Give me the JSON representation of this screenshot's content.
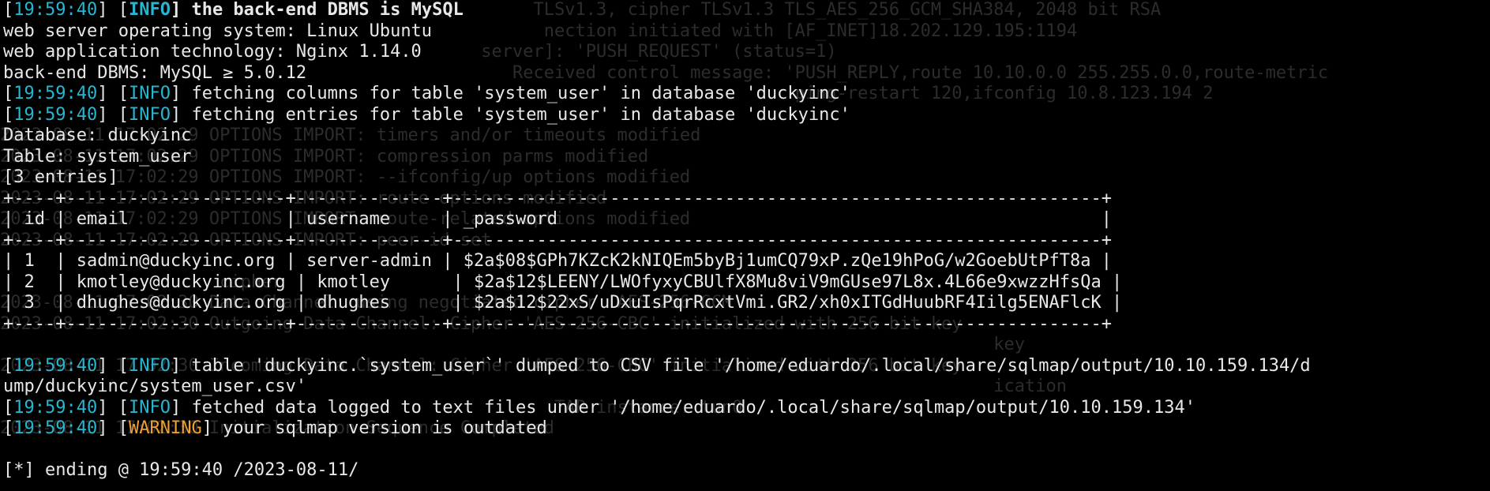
{
  "ghost_lines": [
    "                                                   TLSv1.3, cipher TLSv1.3 TLS_AES_256_GCM_SHA384, 2048 bit RSA",
    "                                                    nection initiated with [AF_INET]18.202.129.195:1194",
    "                                              server]: 'PUSH_REQUEST' (status=1)",
    "                                                 Received control message: 'PUSH_REPLY,route 10.10.0.0 255.255.0.0,route-metric",
    "                                                                            ping-restart 120,ifconfig 10.8.123.194 2",
    "",
    "2023-08-11 17:02:29 OPTIONS IMPORT: timers and/or timeouts modified",
    "2023-08-11 17:02:29 OPTIONS IMPORT: compression parms modified",
    "2023-08-11 17:02:29 OPTIONS IMPORT: --ifconfig/up options modified",
    "2023-08-11 17:02:29 OPTIONS IMPORT: route options modified",
    "2023-08-11 17:02:29 OPTIONS IMPORT: route-related options modified",
    "2023-08-11 17:02:29 OPTIONS IMPORT: peer-id set",
    "",
    "                     cipher",
    "2023-08-11 17:02:30 Data Channel: using negotiated cipher 'AES-256-GCM'",
    "2023-08-11 17:02:30 Outgoing Data Channel: Cipher 'AES-256-CBC' initialized with 256 bit key",
    "                                                                                               key",
    "2023-08-11 17:02:30 Incoming Data Channel: Cipher 'AES-256-CBC' initialized with 256 bit key",
    "                                                                                               ication",
    "                                                     TAP instance: tun0",
    "2023-08-11 17:02:30 Initialization Sequence Completed"
  ],
  "lines": [
    {
      "ts": "19:59:40",
      "level": "INFO",
      "text": " the back-end DBMS is MySQL",
      "bold": true
    },
    {
      "text": "web server operating system: Linux Ubuntu"
    },
    {
      "text": "web application technology: Nginx 1.14.0"
    },
    {
      "text": "back-end DBMS: MySQL ≥ 5.0.12"
    },
    {
      "ts": "19:59:40",
      "level": "INFO",
      "text": " fetching columns for table 'system_user' in database 'duckyinc'"
    },
    {
      "ts": "19:59:40",
      "level": "INFO",
      "text": " fetching entries for table 'system_user' in database 'duckyinc'"
    },
    {
      "text": "Database: duckyinc"
    },
    {
      "text": "Table: system_user"
    },
    {
      "text": "[3 entries]"
    },
    {
      "text": "+----+---------------------+--------------+--------------------------------------------------------------+"
    },
    {
      "text": "| id | email               | username     | _password                                                    |"
    },
    {
      "text": "+----+---------------------+--------------+--------------------------------------------------------------+"
    },
    {
      "text": "| 1  | sadmin@duckyinc.org | server-admin | $2a$08$GPh7KZcK2kNIQEm5byBj1umCQ79xP.zQe19hPoG/w2GoebUtPfT8a |"
    },
    {
      "text": "| 2  | kmotley@duckyinc.org | kmotley      | $2a$12$LEENY/LWOfyxyCBUlfX8Mu8viV9mGUse97L8x.4L66e9xwzzHfsQa |"
    },
    {
      "text": "| 3  | dhughes@duckyinc.org | dhughes      | $2a$12$22xS/uDxuIsPqrRcxtVmi.GR2/xh0xITGdHuubRF4Iilg5ENAFlcK |"
    },
    {
      "text": "+----+---------------------+--------------+--------------------------------------------------------------+"
    },
    {
      "text": ""
    },
    {
      "ts": "19:59:40",
      "level": "INFO",
      "text": " table 'duckyinc.`system_user`' dumped to CSV file '/home/eduardo/.local/share/sqlmap/output/10.10.159.134/d"
    },
    {
      "text": "ump/duckyinc/system_user.csv'"
    },
    {
      "ts": "19:59:40",
      "level": "INFO",
      "text": " fetched data logged to text files under '/home/eduardo/.local/share/sqlmap/output/10.10.159.134'"
    },
    {
      "ts": "19:59:40",
      "level": "WARNING",
      "text": " your sqlmap version is outdated"
    },
    {
      "text": ""
    },
    {
      "text": "[*] ending @ 19:59:40 /2023-08-11/"
    }
  ]
}
